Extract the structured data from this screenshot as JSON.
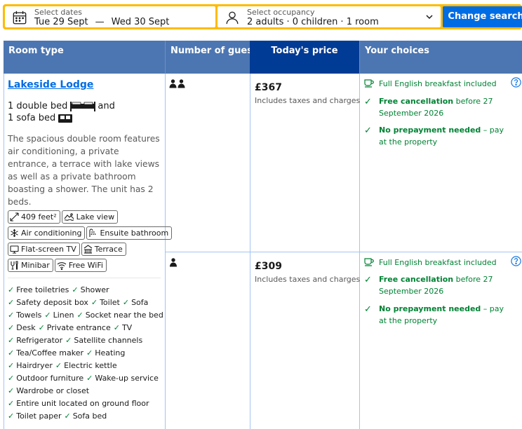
{
  "search": {
    "dates_label": "Select dates",
    "checkin": "Tue 29 Sept",
    "dash": "—",
    "checkout": "Wed 30 Sept",
    "occupancy_label": "Select occupancy",
    "occupancy_value": "2 adults · 0 children · 1 room",
    "button": "Change search"
  },
  "table": {
    "headers": {
      "room_type": "Room type",
      "guests": "Number of guests",
      "price": "Today's price",
      "choices": "Your choices"
    }
  },
  "room": {
    "name": "Lakeside Lodge",
    "bed1": "1 double bed",
    "bed_and": "and",
    "bed2": "1 sofa bed",
    "description": "The spacious double room features air conditioning, a private entrance, a terrace with lake views as well as a private bathroom boasting a shower. The unit has 2 beds.",
    "facilities": {
      "size": "409 feet²",
      "lake_view": "Lake view",
      "air_conditioning": "Air conditioning",
      "ensuite": "Ensuite bathroom",
      "tv": "Flat-screen TV",
      "terrace": "Terrace",
      "minibar": "Minibar",
      "wifi": "Free WiFi"
    },
    "amenities": {
      "a1": "Free toiletries",
      "a2": "Shower",
      "a3": "Safety deposit box",
      "a4": "Toilet",
      "a5": "Sofa",
      "a6": "Towels",
      "a7": "Linen",
      "a8": "Socket near the bed",
      "a9": "Desk",
      "a10": "Private entrance",
      "a11": "TV",
      "a12": "Refrigerator",
      "a13": "Satellite channels",
      "a14": "Tea/Coffee maker",
      "a15": "Heating",
      "a16": "Hairdryer",
      "a17": "Electric kettle",
      "a18": "Outdoor furniture",
      "a19": "Wake-up service",
      "a20": "Wardrobe or closet",
      "a21": "Entire unit located on ground floor",
      "a22": "Toilet paper",
      "a23": "Sofa bed"
    }
  },
  "options": [
    {
      "guests_icon": "two-person-icon",
      "price": "£367",
      "price_note": "Includes taxes and charges",
      "breakfast": "Full English breakfast included",
      "cancel_bold": "Free cancellation",
      "cancel_rest": "before 27 September 2026",
      "prepay_bold": "No prepayment needed",
      "prepay_rest": "– pay at the property"
    },
    {
      "guests_icon": "one-person-icon",
      "price": "£309",
      "price_note": "Includes taxes and charges",
      "breakfast": "Full English breakfast included",
      "cancel_bold": "Free cancellation",
      "cancel_rest": "before 27 September 2026",
      "prepay_bold": "No prepayment needed",
      "prepay_rest": "– pay at the property"
    }
  ],
  "colors": {
    "accent_yellow": "#febb02",
    "primary_blue": "#006ce4",
    "header_blue": "#4c76b2",
    "price_header_blue": "#003b95",
    "success_green": "#008234"
  }
}
